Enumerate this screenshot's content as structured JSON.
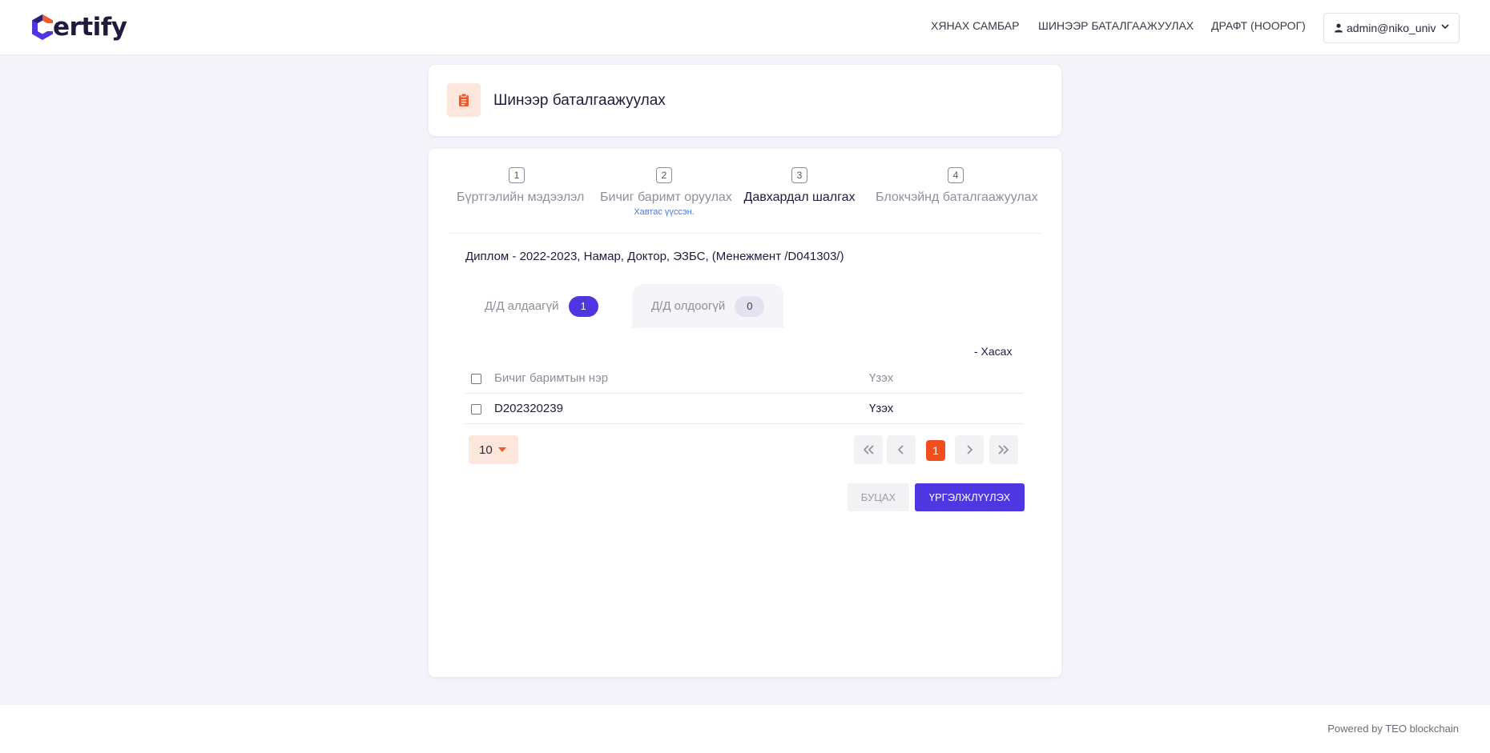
{
  "header": {
    "logo_text": "ertify",
    "nav": [
      {
        "label": "ХЯНАХ САМБАР"
      },
      {
        "label": "ШИНЭЭР БАТАЛГААЖУУЛАХ"
      },
      {
        "label": "ДРАФТ (НООРОГ)"
      }
    ],
    "user": "admin@niko_univ"
  },
  "page": {
    "title": "Шинээр баталгаажуулах"
  },
  "stepper": {
    "steps": [
      {
        "num": "1",
        "label": "Бүртгэлийн мэдээлэл",
        "sub": ""
      },
      {
        "num": "2",
        "label": "Бичиг баримт оруулах",
        "sub": "Хавтас үүссэн."
      },
      {
        "num": "3",
        "label": "Давхардал шалгах",
        "sub": ""
      },
      {
        "num": "4",
        "label": "Блокчэйнд баталгаажуулах",
        "sub": ""
      }
    ],
    "active_step": 3
  },
  "document_info": "Диплом - 2022-2023, Намар, Доктор, ЭЗБС, (Менежмент /D041303/)",
  "tabs": [
    {
      "label": "Д/Д алдаагүй",
      "count": "1"
    },
    {
      "label": "Д/Д олдоогүй",
      "count": "0"
    }
  ],
  "remove_label": "- Хасах",
  "table": {
    "columns": [
      "Бичиг баримтын нэр",
      "Үзэх"
    ],
    "rows": [
      {
        "name": "D202320239",
        "view": "Үзэх"
      }
    ]
  },
  "pagination": {
    "page_size": "10",
    "current_page": "1"
  },
  "buttons": {
    "back": "Буцах",
    "continue": "Үргэлжлүүлэх"
  },
  "footer": {
    "text": "Powered by TEO blockchain"
  },
  "colors": {
    "primary": "#4e37e0",
    "accent": "#f04e1f",
    "accent_soft": "#fde6dc",
    "background": "#f4f3fa"
  }
}
